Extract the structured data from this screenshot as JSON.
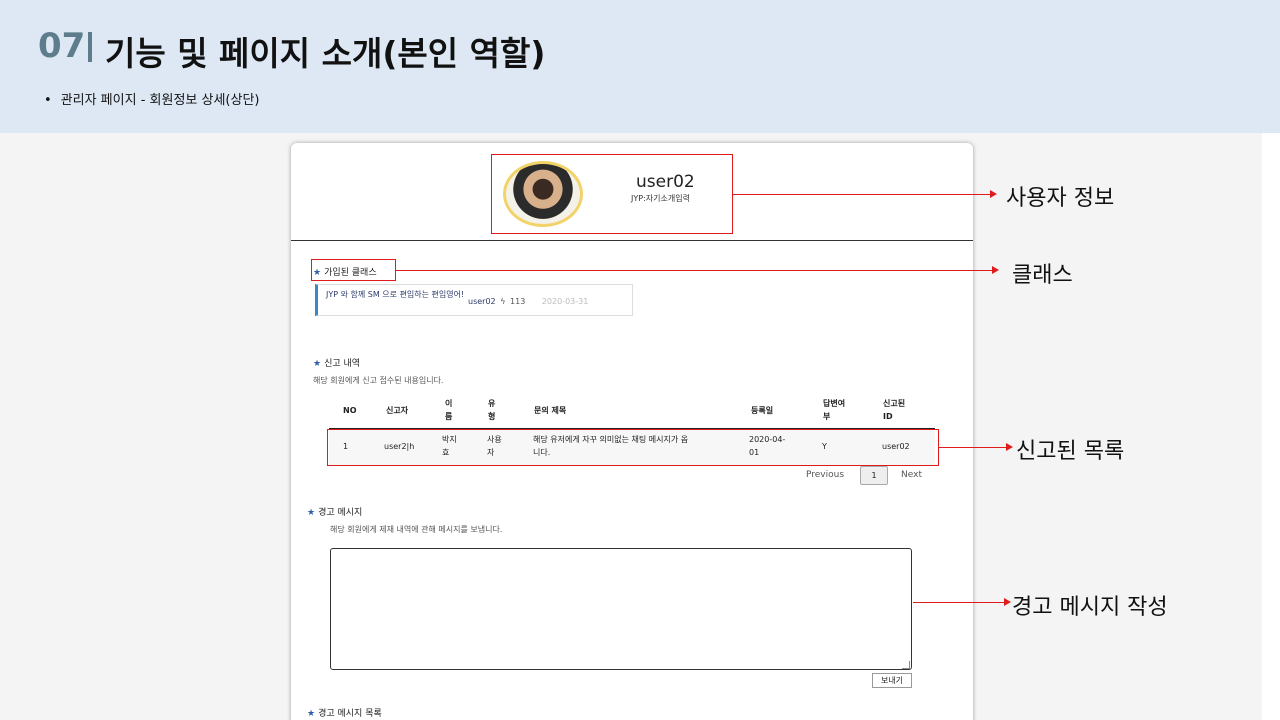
{
  "slide": {
    "number": "07",
    "title": "기능 및 페이지 소개(본인 역할)",
    "subtitle_bullet": "•",
    "subtitle": "관리자 페이지 - 회원정보 상세(상단)"
  },
  "profile": {
    "username": "user02",
    "intro": "JYP:자기소개입력"
  },
  "joined_class": {
    "title": "가입된 클래스",
    "card_text": "JYP 와 함께 SM 으로 편입하는 편입영어!",
    "card_user": "user02",
    "card_count": "113",
    "card_date": "2020-03-31"
  },
  "report": {
    "title": "신고 내역",
    "description": "해당 회원에게 신고 접수된 내용입니다.",
    "headers": [
      "NO",
      "신고자",
      "이름",
      "유형",
      "문의 제목",
      "등록일",
      "답변여부",
      "신고된 ID"
    ],
    "header_lines": {
      "name": [
        "이",
        "름"
      ],
      "type": [
        "유",
        "형"
      ],
      "answered": [
        "답변여",
        "부"
      ],
      "reported": [
        "신고된",
        "ID"
      ]
    },
    "row": {
      "no": "1",
      "reporter": "user2|h",
      "name_lines": [
        "박지",
        "효"
      ],
      "type_lines": [
        "사용",
        "자"
      ],
      "title_lines": [
        "해당 유저에게 자꾸 의미없는 채팅 메시지가 옵",
        "니다."
      ],
      "date_lines": [
        "2020-04-",
        "01"
      ],
      "answered": "Y",
      "reported_id": "user02"
    },
    "pager": {
      "previous": "Previous",
      "page": "1",
      "next": "Next"
    }
  },
  "warning": {
    "title": "경고 메시지",
    "description": "해당 회원에게 제재 내역에 관해 메시지를 보냅니다.",
    "textarea_value": "",
    "send_label": "보내기"
  },
  "warning_list": {
    "title": "경고 메시지 목록"
  },
  "callouts": {
    "user_info": "사용자 정보",
    "class": "클래스",
    "reported_list": "신고된 목록",
    "warning_compose": "경고 메시지 작성"
  },
  "colors": {
    "header_bg": "#dde8f4",
    "slide_number": "#5e7d8c",
    "annotation": "#e01b1b",
    "star": "#2f5ea7"
  }
}
